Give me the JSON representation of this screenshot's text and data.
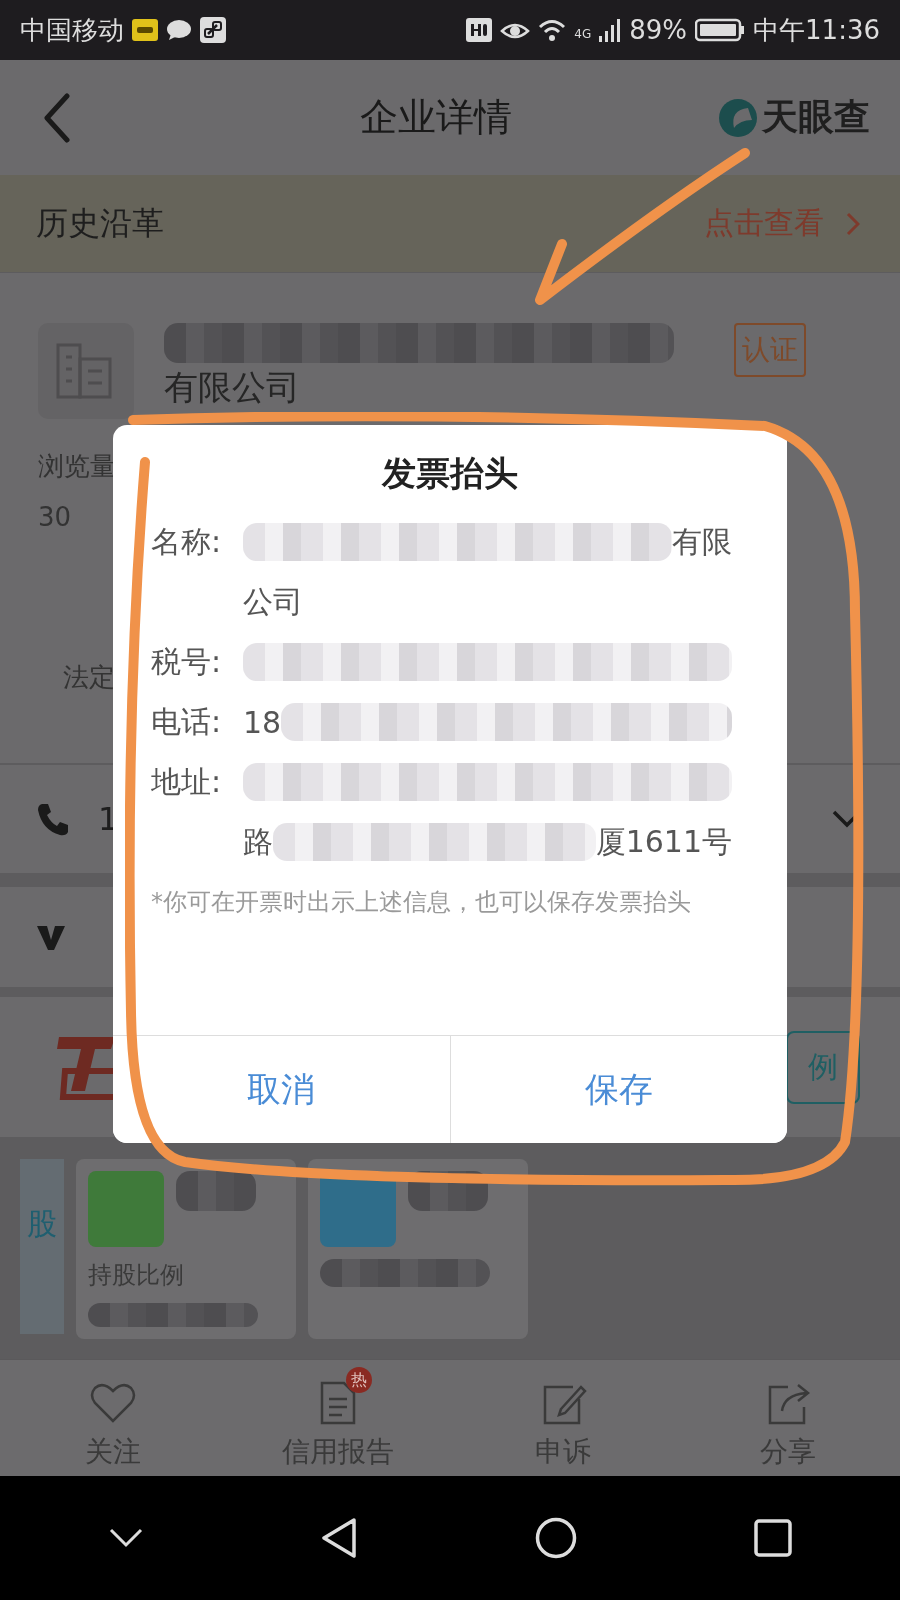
{
  "status_bar": {
    "carrier": "中国移动",
    "network": "4G",
    "battery": "89%",
    "time": "中午11:36"
  },
  "header": {
    "title": "企业详情",
    "logo": "天眼查"
  },
  "history_bar": {
    "label": "历史沿革",
    "link": "点击查看"
  },
  "company": {
    "name_line": "有限公司",
    "badge": "认证",
    "views_label": "浏览量",
    "views": "30",
    "rep_label": "法定"
  },
  "phone_row": {
    "text": "1"
  },
  "banner": {
    "button": "例"
  },
  "shareholders": {
    "tab": "股",
    "ratio_label": "持股比例"
  },
  "dialog": {
    "title": "发票抬头",
    "fields": [
      {
        "label": "名称:",
        "lines": [
          [
            {
              "kind": "blur"
            },
            {
              "kind": "text",
              "text": "有限"
            }
          ],
          [
            {
              "kind": "text",
              "text": "公司"
            }
          ]
        ]
      },
      {
        "label": "税号:",
        "lines": [
          [
            {
              "kind": "blur"
            }
          ]
        ]
      },
      {
        "label": "电话:",
        "lines": [
          [
            {
              "kind": "text",
              "text": "18"
            },
            {
              "kind": "blur"
            }
          ]
        ]
      },
      {
        "label": "地址:",
        "lines": [
          [
            {
              "kind": "blur"
            }
          ],
          [
            {
              "kind": "text",
              "text": "路"
            },
            {
              "kind": "blur"
            },
            {
              "kind": "text",
              "text": "厦1611号"
            }
          ]
        ]
      }
    ],
    "note": "*你可在开票时出示上述信息，也可以保存发票抬头",
    "buttons": [
      {
        "label": "取消"
      },
      {
        "label": "保存"
      }
    ]
  },
  "tab_bar": [
    {
      "label": "关注"
    },
    {
      "label": "信用报告",
      "badge": "热"
    },
    {
      "label": "申诉"
    },
    {
      "label": "分享"
    }
  ]
}
